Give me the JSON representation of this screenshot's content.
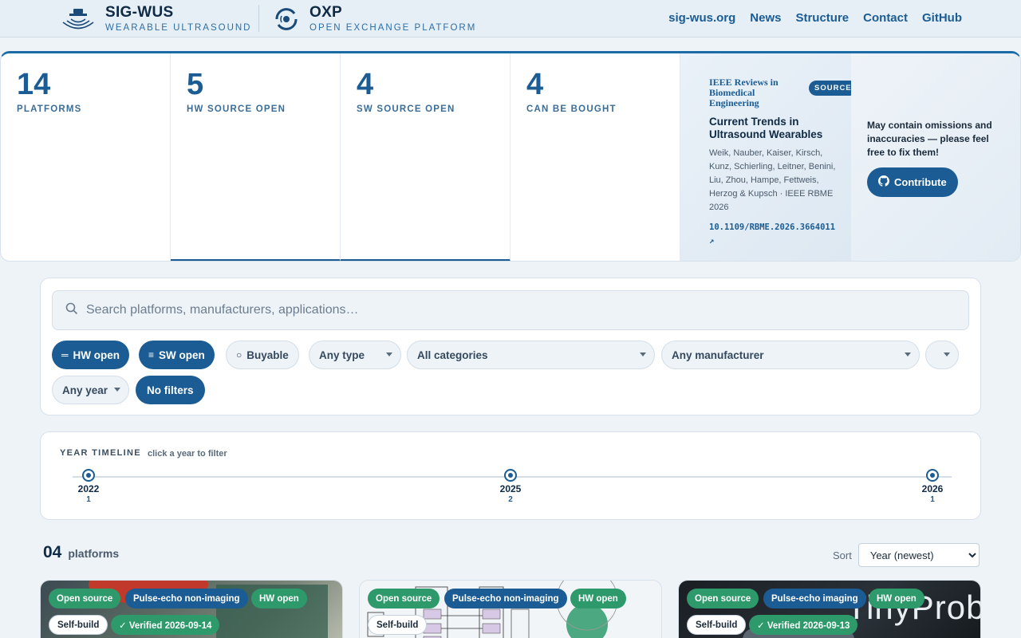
{
  "header": {
    "brand1": {
      "title": "SIG-WUS",
      "subtitle": "WEARABLE ULTRASOUND"
    },
    "brand2": {
      "title": "OXP",
      "subtitle": "OPEN EXCHANGE PLATFORM"
    },
    "nav": [
      "sig-wus.org",
      "News",
      "Structure",
      "Contact",
      "GitHub"
    ]
  },
  "stats": [
    {
      "value": "14",
      "label": "PLATFORMS"
    },
    {
      "value": "5",
      "label": "HW SOURCE OPEN"
    },
    {
      "value": "4",
      "label": "SW SOURCE OPEN"
    },
    {
      "value": "4",
      "label": "CAN BE BOUGHT"
    }
  ],
  "paper": {
    "journal": "IEEE Reviews in Biomedical Engineering",
    "badge": "SOURCE",
    "title": "Current Trends in Ultrasound Wearables",
    "authors": "Weik, Nauber, Kaiser, Kirsch, Kunz, Schierling, Leitner, Benini, Liu, Zhou, Hampe, Fettweis, Herzog & Kupsch · IEEE RBME 2026",
    "doi": "10.1109/RBME.2026.3664011 ↗"
  },
  "contribute": {
    "message": "May contain omissions and inaccuracies — please feel free to fix them!",
    "button": "Contribute"
  },
  "search": {
    "placeholder": "Search platforms, manufacturers, applications…"
  },
  "filters": {
    "hw_open": "HW open",
    "sw_open": "SW open",
    "buyable": "Buyable",
    "type": "Any type",
    "category": "All categories",
    "manufacturer": "Any manufacturer",
    "extra": "",
    "year": "Any year",
    "no_filters": "No filters"
  },
  "timeline": {
    "title": "YEAR TIMELINE",
    "hint": "click a year to filter",
    "years": [
      {
        "year": "2022",
        "count": "1"
      },
      {
        "year": "2025",
        "count": "2"
      },
      {
        "year": "2026",
        "count": "1"
      }
    ]
  },
  "results": {
    "count": "04",
    "label": "platforms",
    "sort_label": "Sort",
    "sort_value": "Year (newest)"
  },
  "cards": [
    {
      "tags": [
        "Open source",
        "Pulse-echo non-imaging",
        "HW open"
      ],
      "tags2": [
        "Self-build",
        "✓ Verified 2026-09-14"
      ]
    },
    {
      "tags": [
        "Open source",
        "Pulse-echo non-imaging",
        "HW open"
      ],
      "tags2": [
        "Self-build"
      ]
    },
    {
      "tags": [
        "Open source",
        "Pulse-echo imaging",
        "HW open"
      ],
      "tags2": [
        "Self-build",
        "✓ Verified 2026-09-13"
      ]
    }
  ],
  "colors": {
    "accent": "#1a5c93",
    "green": "#2e9a6c",
    "background": "#eef3f8"
  }
}
